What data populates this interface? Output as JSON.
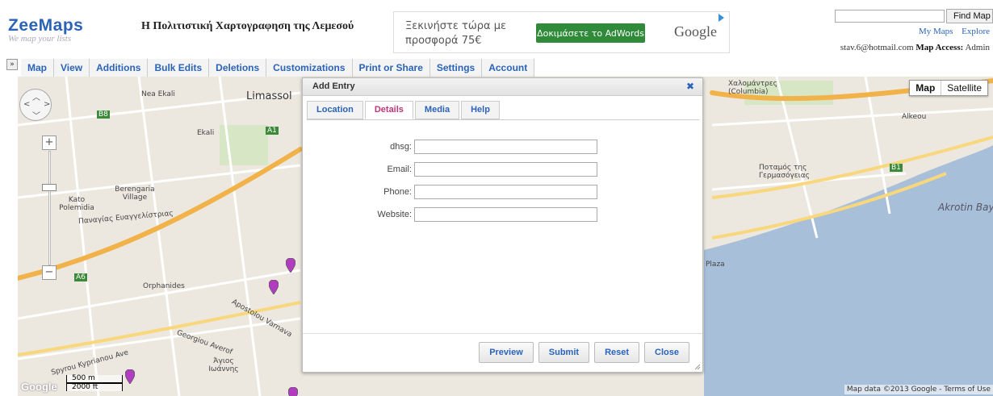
{
  "header": {
    "logo": "ZeeMaps",
    "tagline": "We map your lists",
    "site_title": "Η Πολιτιστική Χαρτογραφηση της Λεμεσού",
    "ad": {
      "text": "Ξεκινήστε τώρα με προσφορά 75€",
      "button": "Δοκιμάσετε το AdWords",
      "brand": "Google"
    },
    "find_button": "Find Map",
    "find_value": "",
    "links": [
      "My Maps",
      "Explore"
    ],
    "user_email": "stav.6@hotmail.com",
    "access_label": "Map Access:",
    "access_value": "Admin"
  },
  "menu": {
    "expand_icon": "»",
    "items": [
      "Map",
      "View",
      "Additions",
      "Bulk Edits",
      "Deletions",
      "Customizations",
      "Print or Share",
      "Settings",
      "Account"
    ]
  },
  "map": {
    "type_buttons": [
      "Map",
      "Satellite"
    ],
    "active_type": "Map",
    "labels": {
      "limassol": "Limassol",
      "nea_ekali": "Nea Ekali",
      "ekali": "Ekali",
      "berengaria": "Berengaria Village",
      "kato_polemidia": "Kato Polemidia",
      "panagias": "Παναγίας Ευαγγελίστριας",
      "orphanides": "Orphanides",
      "agios_ioannis": "Άγιος Ιωάννης",
      "spyrou": "Spyrou Kyprianou Ave",
      "georgiou": "Georgiou Averof",
      "apostolou": "Apostolou Varnava",
      "xalomandres": "Χαλομάντρες (Columbia)",
      "potamos": "Ποταμός της Γερμασόγειας",
      "akrotin": "Akrotin Bay",
      "plaza": "Plaza",
      "alkeou": "Alkeou"
    },
    "road_badges": [
      "A1",
      "B8",
      "A6",
      "B1"
    ],
    "scale_top": "500 m",
    "scale_bottom": "2000 ft",
    "footer": "Map data ©2013 Google - Terms of Use",
    "google_logo": "Google"
  },
  "dialog": {
    "title": "Add Entry",
    "tabs": [
      "Location",
      "Details",
      "Media",
      "Help"
    ],
    "active_tab": "Details",
    "fields": [
      {
        "label": "dhsg:",
        "value": ""
      },
      {
        "label": "Email:",
        "value": ""
      },
      {
        "label": "Phone:",
        "value": ""
      },
      {
        "label": "Website:",
        "value": ""
      }
    ],
    "buttons": [
      "Preview",
      "Submit",
      "Reset",
      "Close"
    ]
  },
  "colors": {
    "brand_blue": "#2a63b8",
    "active_tab": "#c2347a",
    "adwords_green": "#2f8a3a",
    "pin": "#b03cc0",
    "road_orange": "#f2b24a"
  }
}
